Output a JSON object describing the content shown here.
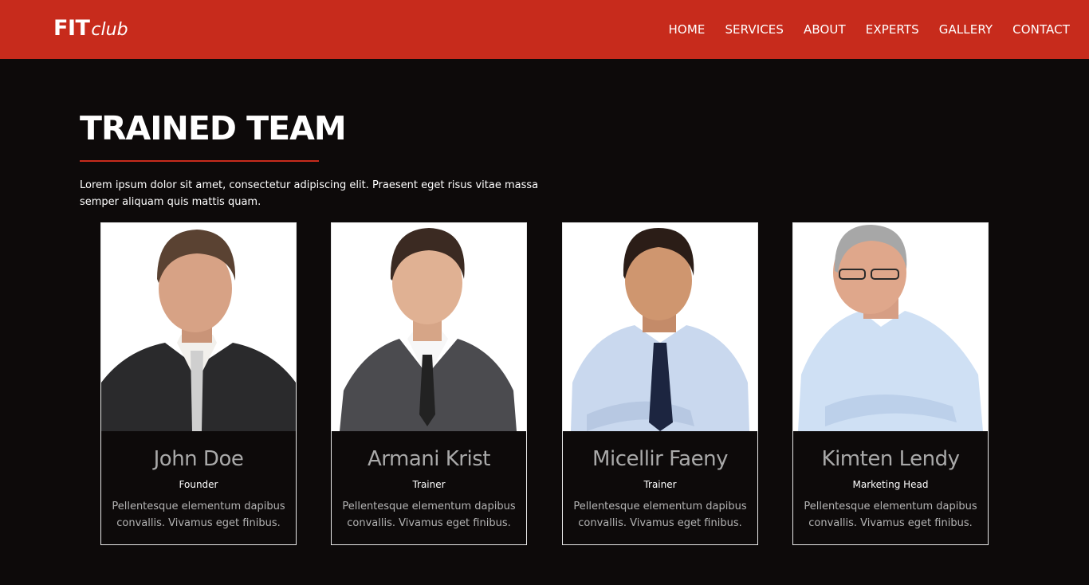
{
  "brand": {
    "strong": "FIT",
    "light": "club"
  },
  "nav": [
    "HOME",
    "SERVICES",
    "ABOUT",
    "EXPERTS",
    "GALLERY",
    "CONTACT"
  ],
  "section": {
    "title": "TRAINED TEAM",
    "intro": "Lorem ipsum dolor sit amet, consectetur adipiscing elit. Praesent eget risus vitae massa semper aliquam quis mattis quam."
  },
  "team": [
    {
      "name": "John Doe",
      "role": "Founder",
      "desc": "Pellentesque elementum dapibus convallis. Vivamus eget finibus."
    },
    {
      "name": "Armani Krist",
      "role": "Trainer",
      "desc": "Pellentesque elementum dapibus convallis. Vivamus eget finibus."
    },
    {
      "name": "Micellir Faeny",
      "role": "Trainer",
      "desc": "Pellentesque elementum dapibus convallis. Vivamus eget finibus."
    },
    {
      "name": "Kimten Lendy",
      "role": "Marketing Head",
      "desc": "Pellentesque elementum dapibus convallis. Vivamus eget finibus."
    }
  ],
  "colors": {
    "accent": "#c72b1c",
    "background": "#0d0a0a",
    "name": "#a9a9a9"
  }
}
